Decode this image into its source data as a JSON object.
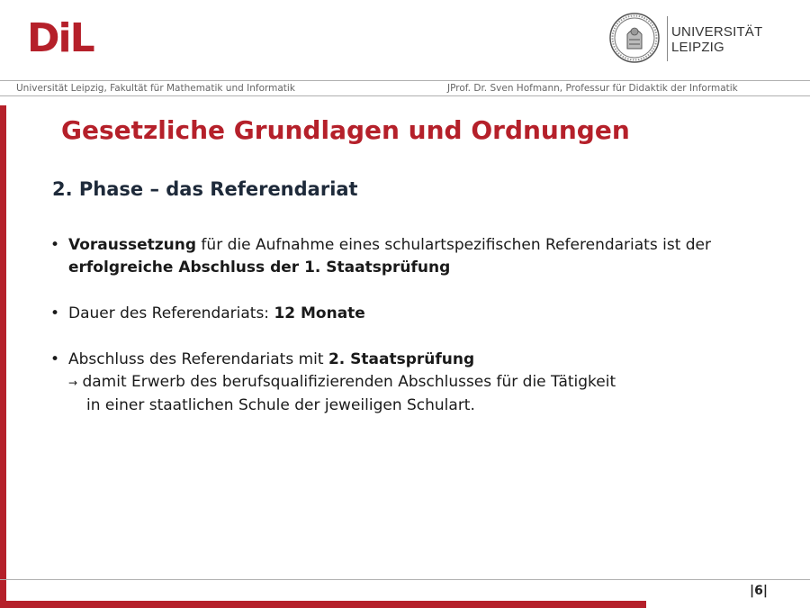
{
  "brand": {
    "logo_text": "DiL",
    "university_line1": "UNIVERSITÄT",
    "university_line2": "LEIPZIG",
    "accent_color": "#b5202a",
    "seal_icon": "university-seal-icon"
  },
  "header": {
    "left": "Universität Leipzig, Fakultät für Mathematik und Informatik",
    "right": "JProf. Dr. Sven Hofmann, Professur für Didaktik der Informatik"
  },
  "slide": {
    "title": "Gesetzliche Grundlagen und Ordnungen",
    "subtitle": "2. Phase – das Referendariat",
    "bullet_symbol": "•",
    "bullets": [
      {
        "bold1": "Voraussetzung",
        "text1": " für die Aufnahme eines schulartspezifischen Referendariats ist der",
        "bold2": "erfolgreiche Abschluss der 1. Staatsprüfung"
      },
      {
        "text1": "Dauer des Referendariats: ",
        "bold1": "12 Monate"
      },
      {
        "text1": "Abschluss des Referendariats mit ",
        "bold1": "2. Staatsprüfung",
        "arrow": "→",
        "sub1": " damit Erwerb des berufsqualifizierenden Abschlusses für die Tätigkeit",
        "sub2": "in einer staatlichen Schule der jeweiligen Schulart."
      }
    ]
  },
  "footer": {
    "page_number": "|6|"
  }
}
